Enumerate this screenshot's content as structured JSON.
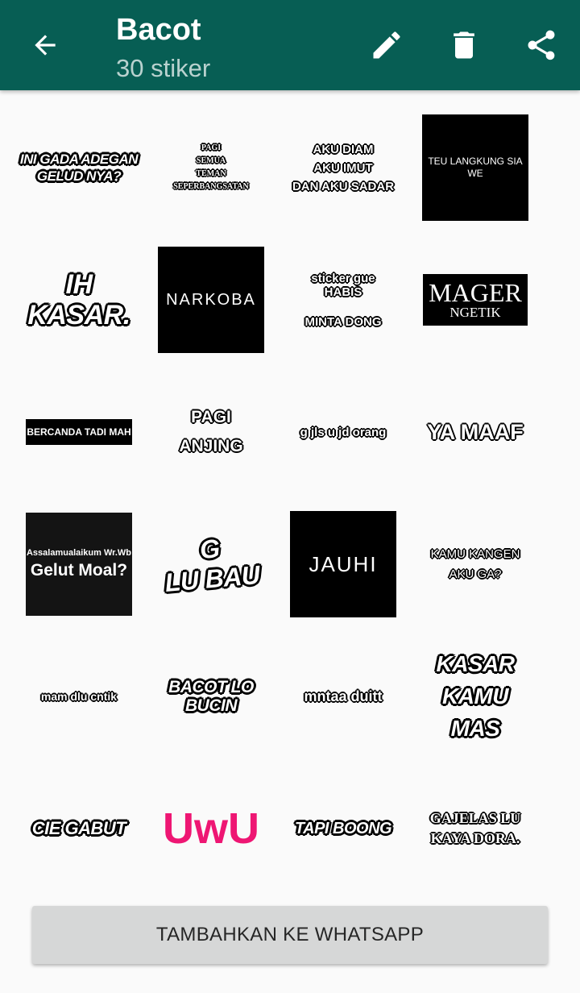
{
  "appbar": {
    "title": "Bacot",
    "subtitle": "30 stiker",
    "color": "#075e54",
    "icons": [
      "arrow-left-icon",
      "pencil-icon",
      "trash-icon",
      "share-icon"
    ]
  },
  "stickers": {
    "s1": "INI GADA ADEGAN\nGELUD NYA?",
    "s2": "PAGI\nSEMUA\nTEMAN\nSEPERBANGSATAN",
    "s3": "AKU DIAM\nAKU IMUT\nDAN AKU SADAR",
    "s4": "TEU LANGKUNG SIA\nWE",
    "s5": "IH KASAR.",
    "s6": "NARKOBA",
    "s7a": "sticker gue\nHABIS",
    "s7b": "MINTA DONG",
    "s8a": "MAGER",
    "s8b": "NGETIK",
    "s9": "BERCANDA TADI MAH",
    "s10": "PAGI\nANJING",
    "s11": "g jls u jd orang",
    "s12": "YA MAAF",
    "s13a": "Assalamualaikum Wr.Wb",
    "s13b": "Gelut Moal?",
    "s14a": "G",
    "s14b": "LU BAU",
    "s15": "JAUHI",
    "s16": "KAMU KANGEN\nAKU GA?",
    "s17": "mam dlu cntik",
    "s18": "BACOT LO\nBUCIN",
    "s19": "mntaa duitt",
    "s20": "KASAR\nKAMU\nMAS",
    "s21": "CIE GABUT",
    "s22": "UwU",
    "s23": "TAPI BOONG",
    "s24": "GAJELAS LU\nKAYA DORA."
  },
  "uwu_color": "#ee1673",
  "add_button": {
    "label": "TAMBAHKAN KE WHATSAPP"
  }
}
